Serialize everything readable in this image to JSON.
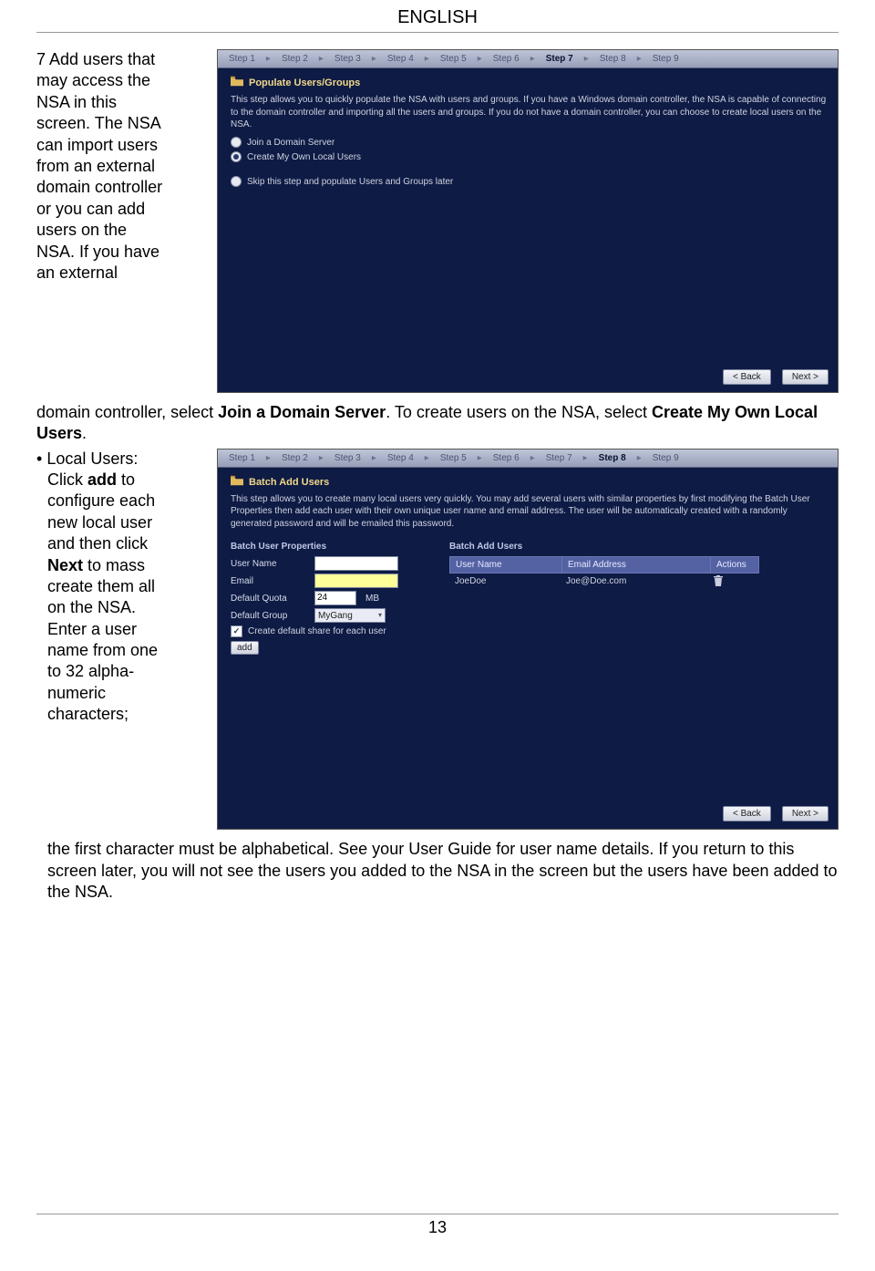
{
  "header": "ENGLISH",
  "step7": {
    "intro_left1": "Add users that may access the NSA in this screen. The NSA can import users from an external domain controller or you can add users on the NSA. If you have an external",
    "tail1a": "domain controller, select ",
    "bold1": "Join a Domain Server",
    "tail1b": ". To create users on the NSA, select ",
    "bold2": "Create My Own Local Users",
    "tail1c": "."
  },
  "local": {
    "p1a": "Local Users: Click ",
    "b_add": "add",
    "p1b": " to configure each new local user and then click ",
    "b_next": "Next",
    "p1c": " to mass create them all on the NSA. Enter a user name from one to 32 alpha-numeric characters;",
    "tail": "the first character must be alphabetical. See your User Guide for user name details. If you return to this screen later, you will not see the users you added to the NSA in the screen but the users have been added to the NSA."
  },
  "steps": {
    "s1": "Step 1",
    "s2": "Step 2",
    "s3": "Step 3",
    "s4": "Step 4",
    "s5": "Step 5",
    "s6": "Step 6",
    "s7": "Step 7",
    "s8": "Step 8",
    "s9": "Step 9"
  },
  "shot7": {
    "title": "Populate Users/Groups",
    "desc": "This step allows you to quickly populate the NSA with users and groups. If you have a Windows domain controller, the NSA is capable of connecting to the domain controller and importing all the users and groups. If you do not have a domain controller, you can choose to create local users on the NSA.",
    "opt1": "Join a Domain Server",
    "opt2": "Create My Own Local Users",
    "opt3": "Skip this step and populate Users and Groups later",
    "back": "<  Back",
    "next": "Next  >"
  },
  "shot8": {
    "title": "Batch Add Users",
    "desc": "This step allows you to create many local users very quickly. You may add several users with similar properties by first modifying the Batch User Properties then add each user with their own unique user name and email address. The user will be automatically created with a randomly generated password and will be emailed this password.",
    "props_title": "Batch User Properties",
    "addusers_title": "Batch Add Users",
    "lbl_user": "User Name",
    "lbl_email": "Email",
    "lbl_quota": "Default Quota",
    "quota_val": "24",
    "quota_unit": "MB",
    "lbl_group": "Default Group",
    "group_val": "MyGang",
    "chk_label": "Create default share for each user",
    "add_btn": "add",
    "th_user": "User Name",
    "th_email": "Email Address",
    "th_actions": "Actions",
    "row_user": "JoeDoe",
    "row_email": "Joe@Doe.com",
    "back": "<  Back",
    "next": "Next  >"
  },
  "page_number": "13"
}
